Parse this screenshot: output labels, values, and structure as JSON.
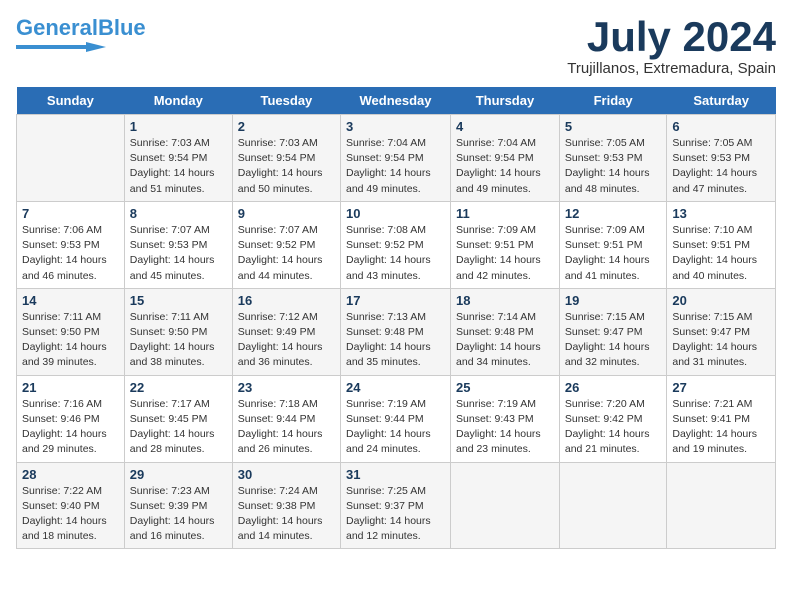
{
  "header": {
    "logo_line1": "General",
    "logo_line2": "Blue",
    "month_year": "July 2024",
    "location": "Trujillanos, Extremadura, Spain"
  },
  "weekdays": [
    "Sunday",
    "Monday",
    "Tuesday",
    "Wednesday",
    "Thursday",
    "Friday",
    "Saturday"
  ],
  "weeks": [
    [
      {
        "day": "",
        "sunrise": "",
        "sunset": "",
        "daylight": ""
      },
      {
        "day": "1",
        "sunrise": "Sunrise: 7:03 AM",
        "sunset": "Sunset: 9:54 PM",
        "daylight": "Daylight: 14 hours and 51 minutes."
      },
      {
        "day": "2",
        "sunrise": "Sunrise: 7:03 AM",
        "sunset": "Sunset: 9:54 PM",
        "daylight": "Daylight: 14 hours and 50 minutes."
      },
      {
        "day": "3",
        "sunrise": "Sunrise: 7:04 AM",
        "sunset": "Sunset: 9:54 PM",
        "daylight": "Daylight: 14 hours and 49 minutes."
      },
      {
        "day": "4",
        "sunrise": "Sunrise: 7:04 AM",
        "sunset": "Sunset: 9:54 PM",
        "daylight": "Daylight: 14 hours and 49 minutes."
      },
      {
        "day": "5",
        "sunrise": "Sunrise: 7:05 AM",
        "sunset": "Sunset: 9:53 PM",
        "daylight": "Daylight: 14 hours and 48 minutes."
      },
      {
        "day": "6",
        "sunrise": "Sunrise: 7:05 AM",
        "sunset": "Sunset: 9:53 PM",
        "daylight": "Daylight: 14 hours and 47 minutes."
      }
    ],
    [
      {
        "day": "7",
        "sunrise": "Sunrise: 7:06 AM",
        "sunset": "Sunset: 9:53 PM",
        "daylight": "Daylight: 14 hours and 46 minutes."
      },
      {
        "day": "8",
        "sunrise": "Sunrise: 7:07 AM",
        "sunset": "Sunset: 9:53 PM",
        "daylight": "Daylight: 14 hours and 45 minutes."
      },
      {
        "day": "9",
        "sunrise": "Sunrise: 7:07 AM",
        "sunset": "Sunset: 9:52 PM",
        "daylight": "Daylight: 14 hours and 44 minutes."
      },
      {
        "day": "10",
        "sunrise": "Sunrise: 7:08 AM",
        "sunset": "Sunset: 9:52 PM",
        "daylight": "Daylight: 14 hours and 43 minutes."
      },
      {
        "day": "11",
        "sunrise": "Sunrise: 7:09 AM",
        "sunset": "Sunset: 9:51 PM",
        "daylight": "Daylight: 14 hours and 42 minutes."
      },
      {
        "day": "12",
        "sunrise": "Sunrise: 7:09 AM",
        "sunset": "Sunset: 9:51 PM",
        "daylight": "Daylight: 14 hours and 41 minutes."
      },
      {
        "day": "13",
        "sunrise": "Sunrise: 7:10 AM",
        "sunset": "Sunset: 9:51 PM",
        "daylight": "Daylight: 14 hours and 40 minutes."
      }
    ],
    [
      {
        "day": "14",
        "sunrise": "Sunrise: 7:11 AM",
        "sunset": "Sunset: 9:50 PM",
        "daylight": "Daylight: 14 hours and 39 minutes."
      },
      {
        "day": "15",
        "sunrise": "Sunrise: 7:11 AM",
        "sunset": "Sunset: 9:50 PM",
        "daylight": "Daylight: 14 hours and 38 minutes."
      },
      {
        "day": "16",
        "sunrise": "Sunrise: 7:12 AM",
        "sunset": "Sunset: 9:49 PM",
        "daylight": "Daylight: 14 hours and 36 minutes."
      },
      {
        "day": "17",
        "sunrise": "Sunrise: 7:13 AM",
        "sunset": "Sunset: 9:48 PM",
        "daylight": "Daylight: 14 hours and 35 minutes."
      },
      {
        "day": "18",
        "sunrise": "Sunrise: 7:14 AM",
        "sunset": "Sunset: 9:48 PM",
        "daylight": "Daylight: 14 hours and 34 minutes."
      },
      {
        "day": "19",
        "sunrise": "Sunrise: 7:15 AM",
        "sunset": "Sunset: 9:47 PM",
        "daylight": "Daylight: 14 hours and 32 minutes."
      },
      {
        "day": "20",
        "sunrise": "Sunrise: 7:15 AM",
        "sunset": "Sunset: 9:47 PM",
        "daylight": "Daylight: 14 hours and 31 minutes."
      }
    ],
    [
      {
        "day": "21",
        "sunrise": "Sunrise: 7:16 AM",
        "sunset": "Sunset: 9:46 PM",
        "daylight": "Daylight: 14 hours and 29 minutes."
      },
      {
        "day": "22",
        "sunrise": "Sunrise: 7:17 AM",
        "sunset": "Sunset: 9:45 PM",
        "daylight": "Daylight: 14 hours and 28 minutes."
      },
      {
        "day": "23",
        "sunrise": "Sunrise: 7:18 AM",
        "sunset": "Sunset: 9:44 PM",
        "daylight": "Daylight: 14 hours and 26 minutes."
      },
      {
        "day": "24",
        "sunrise": "Sunrise: 7:19 AM",
        "sunset": "Sunset: 9:44 PM",
        "daylight": "Daylight: 14 hours and 24 minutes."
      },
      {
        "day": "25",
        "sunrise": "Sunrise: 7:19 AM",
        "sunset": "Sunset: 9:43 PM",
        "daylight": "Daylight: 14 hours and 23 minutes."
      },
      {
        "day": "26",
        "sunrise": "Sunrise: 7:20 AM",
        "sunset": "Sunset: 9:42 PM",
        "daylight": "Daylight: 14 hours and 21 minutes."
      },
      {
        "day": "27",
        "sunrise": "Sunrise: 7:21 AM",
        "sunset": "Sunset: 9:41 PM",
        "daylight": "Daylight: 14 hours and 19 minutes."
      }
    ],
    [
      {
        "day": "28",
        "sunrise": "Sunrise: 7:22 AM",
        "sunset": "Sunset: 9:40 PM",
        "daylight": "Daylight: 14 hours and 18 minutes."
      },
      {
        "day": "29",
        "sunrise": "Sunrise: 7:23 AM",
        "sunset": "Sunset: 9:39 PM",
        "daylight": "Daylight: 14 hours and 16 minutes."
      },
      {
        "day": "30",
        "sunrise": "Sunrise: 7:24 AM",
        "sunset": "Sunset: 9:38 PM",
        "daylight": "Daylight: 14 hours and 14 minutes."
      },
      {
        "day": "31",
        "sunrise": "Sunrise: 7:25 AM",
        "sunset": "Sunset: 9:37 PM",
        "daylight": "Daylight: 14 hours and 12 minutes."
      },
      {
        "day": "",
        "sunrise": "",
        "sunset": "",
        "daylight": ""
      },
      {
        "day": "",
        "sunrise": "",
        "sunset": "",
        "daylight": ""
      },
      {
        "day": "",
        "sunrise": "",
        "sunset": "",
        "daylight": ""
      }
    ]
  ]
}
